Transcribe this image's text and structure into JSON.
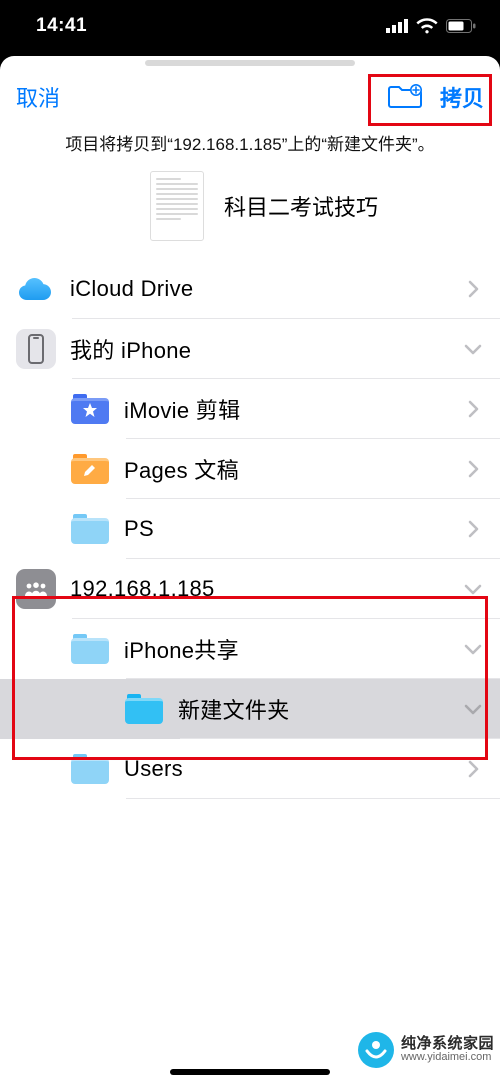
{
  "status": {
    "time": "14:41"
  },
  "nav": {
    "cancel": "取消",
    "confirm": "拷贝"
  },
  "subtitle": "项目将拷贝到“192.168.1.185”上的“新建文件夹”。",
  "previewItem": {
    "name": "科目二考试技巧"
  },
  "locations": [
    {
      "label": "iCloud Drive",
      "disclosure": "right"
    },
    {
      "label": "我的 iPhone",
      "disclosure": "down",
      "children": [
        {
          "label": "iMovie 剪辑",
          "disclosure": "right"
        },
        {
          "label": "Pages 文稿",
          "disclosure": "right"
        },
        {
          "label": "PS",
          "disclosure": "right"
        }
      ]
    },
    {
      "label": "192.168.1.185",
      "disclosure": "down",
      "children": [
        {
          "label": "iPhone共享",
          "disclosure": "down",
          "children": [
            {
              "label": "新建文件夹",
              "disclosure": "down",
              "selected": true
            }
          ]
        },
        {
          "label": "Users",
          "disclosure": "right"
        }
      ]
    }
  ],
  "colors": {
    "accent": "#007aff",
    "annotation": "#e30613"
  },
  "watermark": {
    "title": "纯净系统家园",
    "url": "www.yidaimei.com"
  }
}
